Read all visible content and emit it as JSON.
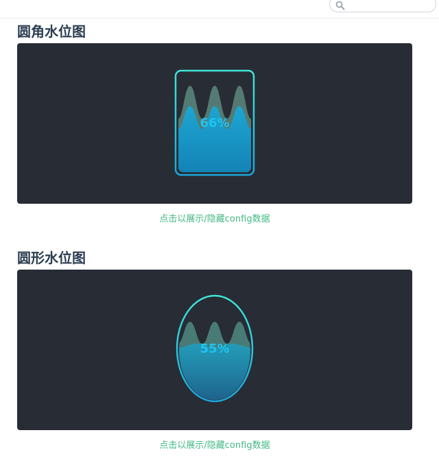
{
  "header": {
    "search": {
      "placeholder": "",
      "value": ""
    }
  },
  "sections": [
    {
      "title": "圆角水位图",
      "shape": "roundRect",
      "percent_label": "66%",
      "level": 0.66,
      "toggle_label": "点击以展示/隐藏config数据"
    },
    {
      "title": "圆形水位图",
      "shape": "ellipse",
      "percent_label": "55%",
      "level": 0.55,
      "toggle_label": "点击以展示/隐藏config数据"
    }
  ],
  "colors": {
    "panel_bg": "#282c34",
    "border_top": "#3fe6d9",
    "border_bottom": "#1aa7e0",
    "fill_top": "#1aa8d6",
    "fill_bottom": "#1483b6",
    "wave": "#5a8a80",
    "text": "#1fc4f0",
    "link": "#42b983",
    "title": "#2c3e50"
  },
  "icons": {
    "search": "search-icon"
  }
}
